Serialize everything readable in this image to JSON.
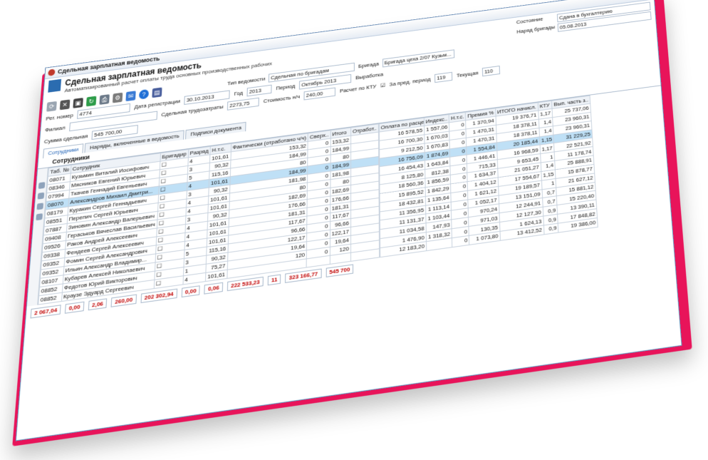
{
  "window": {
    "title": "Сдельная зарплатная ведомость",
    "close": "✕"
  },
  "header": {
    "title": "Сдельная зарплатная ведомость",
    "subtitle": "Автоматизированный расчет оплаты труда основных производственных рабочих",
    "state_label": "Состояние",
    "state_value": "Сдана в бухгалтерию",
    "type_label": "Тип ведомости",
    "type_value": "Сдельная по бригадам",
    "brigade_label": "Бригада",
    "brigade_value": "Бригада цеха 2/07 Кузьм...",
    "brigade_date_label": "Наряд бригады",
    "brigade_date_value": "05.08.2013"
  },
  "fields": {
    "reg_label": "Рег. номер",
    "reg_value": "4774",
    "date_label": "Дата регистрации",
    "date_value": "30.10.2013",
    "year_label": "Год",
    "year_value": "2013",
    "period_label": "Период",
    "period_value": "Октябрь 2013",
    "branch_label": "Филиал",
    "cost_label": "Стоимость н/ч",
    "cost_value": "240,00",
    "ktu_label": "Расчет по КТУ",
    "output_label": "Выработка",
    "prev_label": "За пред. период",
    "prev_value": "119",
    "cur_label": "Текущая",
    "cur_value": "110",
    "labor_label": "Сдельная трудозатраты",
    "labor_value": "2273,75",
    "sum_label": "Сумма сдельная",
    "sum_value": "545 700,00"
  },
  "tabs": [
    "Сотрудники",
    "Наряды, включенные в ведомость",
    "Подписи документа"
  ],
  "inner_tab": "Сотрудники",
  "section_title": "Сотрудники",
  "columns": [
    "Таб. №",
    "Сотрудник",
    "Бригадир",
    "Разряд",
    "Н.т.с.",
    "Фактически (отработано ч/ч)",
    "Сверх..",
    "Итого",
    "Отработ.."
  ],
  "rows": [
    {
      "tab": "08071",
      "name": "Кузьмин Виталий Иосифович",
      "rank": "4",
      "a": "101,61",
      "b": "153,32",
      "c": "0",
      "d": "153,32"
    },
    {
      "tab": "08346",
      "name": "Мясников Евгений Юрьевич",
      "rank": "3",
      "a": "90,32",
      "b": "184,99",
      "c": "0",
      "d": "184,99"
    },
    {
      "tab": "07994",
      "name": "Ткачев Геннадий Евгеньевич",
      "rank": "5",
      "a": "115,16",
      "b": "80",
      "c": "0",
      "d": "80"
    },
    {
      "tab": "08070",
      "name": "Александров Михаил Дмитри...",
      "rank": "4",
      "a": "101,61",
      "b": "184,99",
      "c": "0",
      "d": "184,99",
      "sel": true
    },
    {
      "tab": "08179",
      "name": "Куракин Сергей Геннадьевич",
      "rank": "3",
      "a": "90,32",
      "b": "181,98",
      "c": "0",
      "d": "181,98"
    },
    {
      "tab": "08551",
      "name": "Перепич Сергей Юрьевич",
      "rank": "4",
      "a": "101,61",
      "b": "80",
      "c": "0",
      "d": "80"
    },
    {
      "tab": "07887",
      "name": "Зиновин Александр Валерьевич",
      "rank": "4",
      "a": "101,61",
      "b": "182,69",
      "c": "0",
      "d": "182,69"
    },
    {
      "tab": "09408",
      "name": "Гераськов Вячеслав Васильевич",
      "rank": "3",
      "a": "90,32",
      "b": "176,66",
      "c": "0",
      "d": "176,66"
    },
    {
      "tab": "09526",
      "name": "Раков Андрей Алексеевич",
      "rank": "4",
      "a": "101,61",
      "b": "181,31",
      "c": "0",
      "d": "181,31"
    },
    {
      "tab": "09338",
      "name": "Фендеев Сергей Алексеевич",
      "rank": "4",
      "a": "101,61",
      "b": "117,67",
      "c": "0",
      "d": "117,67"
    },
    {
      "tab": "09352",
      "name": "Фомин Сергей Александрович",
      "rank": "4",
      "a": "101,61",
      "b": "96,66",
      "c": "0",
      "d": "96,66"
    },
    {
      "tab": "09352",
      "name": "Ильин Александр Владимир...",
      "rank": "5",
      "a": "115,16",
      "b": "122,17",
      "c": "0",
      "d": "122,17"
    },
    {
      "tab": "08107",
      "name": "Кубарев Алексей Николаевич",
      "rank": "3",
      "a": "90,32",
      "b": "19,64",
      "c": "0",
      "d": "19,64"
    },
    {
      "tab": "08852",
      "name": "Федотов Юрий Викторович",
      "rank": "1",
      "a": "75,27",
      "b": "120",
      "c": "0",
      "d": "120"
    },
    {
      "tab": "08852",
      "name": "Краузе Эдуард Сергеевич",
      "rank": "4",
      "a": "101,61",
      "b": "",
      "c": "",
      "d": ""
    }
  ],
  "right_columns": [
    "Оплата по расцен..",
    "Индекс..",
    "Н.т.с.",
    "Премия %",
    "ИТОГО начисл.",
    "КТУ",
    "Вып. часть з.."
  ],
  "right_rows": [
    [
      "16 578,55",
      "1 557,06",
      "0",
      "1 370,94",
      "19 376,71",
      "1,17",
      "25 737,06"
    ],
    [
      "16 700,30",
      "1 670,03",
      "0",
      "1 470,31",
      "18 378,11",
      "1,4",
      "23 960,31"
    ],
    [
      "9 212,50",
      "1 670,83",
      "0",
      "1 470,31",
      "18 378,11",
      "1,4",
      "23 960,31"
    ],
    [
      "16 756,09",
      "1 874,69",
      "0",
      "1 554,84",
      "20 185,44",
      "1,15",
      "31 229,25"
    ],
    [
      "16 454,43",
      "1 643,84",
      "0",
      "1 446,41",
      "16 968,59",
      "1,17",
      "22 521,92"
    ],
    [
      "8 125,80",
      "812,38",
      "0",
      "715,33",
      "9 653,45",
      "1",
      "11 178,74"
    ],
    [
      "18 560,36",
      "1 856,59",
      "0",
      "1 634,37",
      "21 051,27",
      "1,4",
      "25 888,91"
    ],
    [
      "15 895,52",
      "1 842,29",
      "0",
      "1 404,12",
      "17 554,67",
      "1,15",
      "15 878,77"
    ],
    [
      "18 432,81",
      "1 135,64",
      "0",
      "1 621,12",
      "19 189,57",
      "1",
      "21 627,12"
    ],
    [
      "11 356,95",
      "1 113,14",
      "0",
      "1 052,17",
      "13 151,09",
      "0,7",
      "15 881,12"
    ],
    [
      "11 131,37",
      "1 103,44",
      "0",
      "970,24",
      "12 244,91",
      "0,7",
      "15 220,40"
    ],
    [
      "11 034,58",
      "147,93",
      "0",
      "971,03",
      "12 127,30",
      "0,9",
      "13 390,11"
    ],
    [
      "1 476,90",
      "1 318,32",
      "0",
      "130,35",
      "1 624,13",
      "0,9",
      "17 848,82"
    ],
    [
      "12 183,20",
      "",
      "0",
      "1 073,80",
      "13 412,52",
      "0,9",
      "19 386,00"
    ]
  ],
  "footer": [
    "2 067,04",
    "0,00",
    "2,06",
    "260,00",
    "202 302,94",
    "0,00",
    "0,06",
    "222 533,23",
    "11",
    "323 166,77",
    "545 700"
  ]
}
